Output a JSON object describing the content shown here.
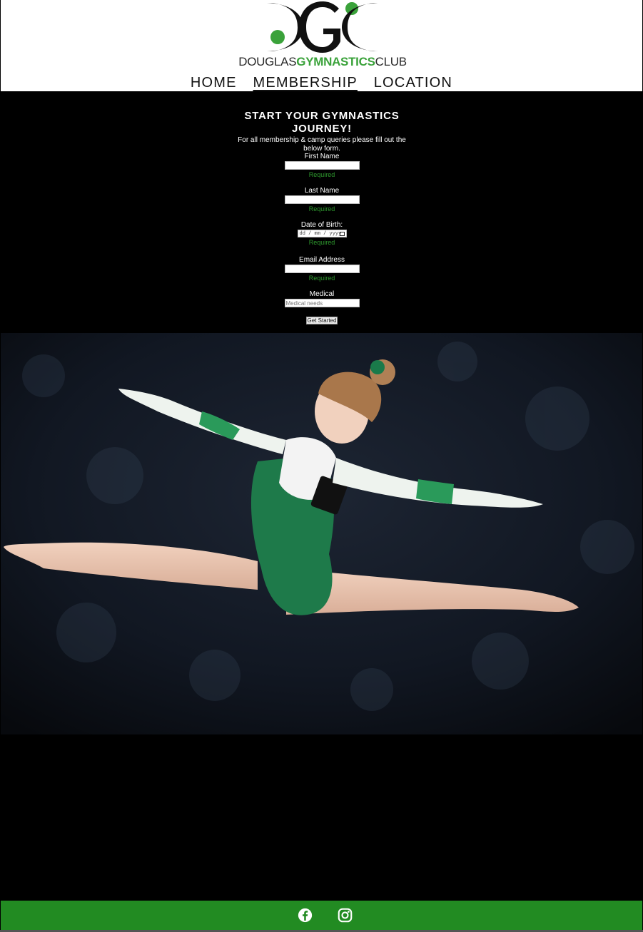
{
  "logo": {
    "word1": "DOUGLAS",
    "word2": "GYMNASTICS",
    "word3": "CLUB",
    "colors": {
      "dark": "#111111",
      "green": "#3aa23a"
    }
  },
  "nav": {
    "items": [
      {
        "label": "HOME",
        "active": false
      },
      {
        "label": "MEMBERSHIP",
        "active": true
      },
      {
        "label": "LOCATION",
        "active": false
      }
    ]
  },
  "form": {
    "title": "START YOUR GYMNASTICS JOURNEY!",
    "intro": "For all membership & camp queries please fill out the below form.",
    "fields": [
      {
        "label": "First Name",
        "value": "",
        "hint": "Required"
      },
      {
        "label": "Last Name",
        "value": "",
        "hint": "Required"
      },
      {
        "label": "Date of Birth:",
        "value": "dd / mm / yyyy",
        "hint": "Required"
      },
      {
        "label": "Email Address",
        "value": "",
        "hint": "Required"
      },
      {
        "label": "Medical",
        "placeholder": "Medical needs"
      }
    ],
    "submit_label": "Get Started"
  },
  "hero": {
    "icon": "gymnast-leap-photo"
  },
  "footer": {
    "color": "#228b22",
    "icons": [
      "facebook-icon",
      "instagram-icon"
    ]
  }
}
